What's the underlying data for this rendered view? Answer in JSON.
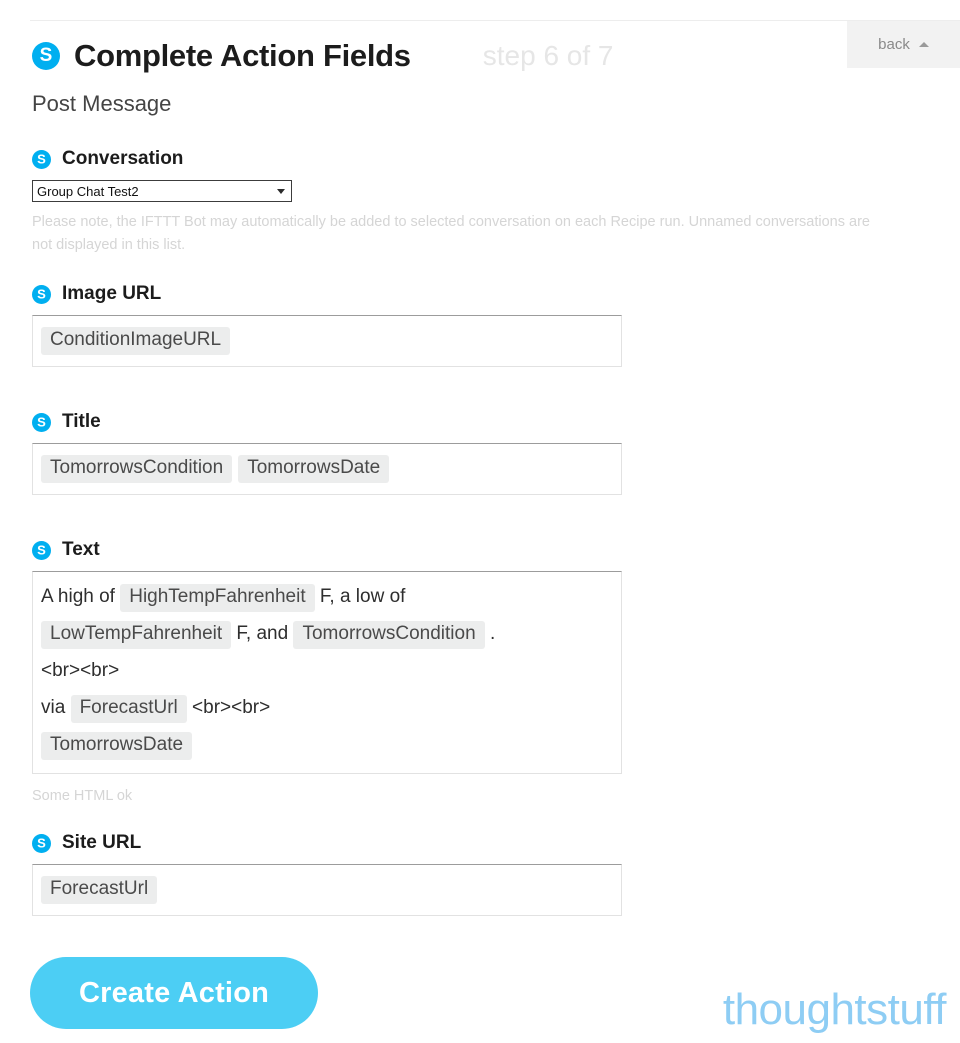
{
  "header": {
    "icon": "skype-icon",
    "title": "Complete Action Fields",
    "step": "step 6 of 7",
    "back_label": "back",
    "back_caret": "caret-up-icon",
    "subtitle": "Post Message"
  },
  "fields": {
    "conversation": {
      "icon": "skype-icon",
      "label": "Conversation",
      "selected": "Group Chat Test2",
      "caret": "caret-down-icon",
      "helper": "Please note, the IFTTT Bot may automatically be added to selected conversation on each Recipe run. Unnamed conversations are not displayed in this list."
    },
    "image_url": {
      "icon": "skype-icon",
      "label": "Image URL",
      "tokens": [
        "ConditionImageURL"
      ]
    },
    "title": {
      "icon": "skype-icon",
      "label": "Title",
      "tokens": [
        "TomorrowsCondition",
        "TomorrowsDate"
      ]
    },
    "text": {
      "icon": "skype-icon",
      "label": "Text",
      "helper": "Some HTML ok",
      "lines": [
        [
          {
            "type": "plain",
            "value": "A high of "
          },
          {
            "type": "token",
            "value": "HighTempFahrenheit"
          },
          {
            "type": "plain",
            "value": " F, a low of"
          }
        ],
        [
          {
            "type": "token",
            "value": "LowTempFahrenheit"
          },
          {
            "type": "plain",
            "value": " F, and "
          },
          {
            "type": "token",
            "value": "TomorrowsCondition"
          },
          {
            "type": "plain",
            "value": " ."
          }
        ],
        [
          {
            "type": "plain",
            "value": "<br><br>"
          }
        ],
        [
          {
            "type": "plain",
            "value": "via "
          },
          {
            "type": "token",
            "value": "ForecastUrl"
          },
          {
            "type": "plain",
            "value": " <br><br>"
          }
        ],
        [
          {
            "type": "token",
            "value": "TomorrowsDate"
          }
        ]
      ]
    },
    "site_url": {
      "icon": "skype-icon",
      "label": "Site URL",
      "tokens": [
        "ForecastUrl"
      ]
    }
  },
  "footer": {
    "create_label": "Create Action",
    "watermark": "thoughtstuff"
  },
  "colors": {
    "skype_blue": "#00aff0",
    "cta_blue": "#4ccef4",
    "token_bg": "#eceded",
    "watermark_blue": "#8ecdf4",
    "step_gray": "#e6e6e6",
    "helper_gray": "#d5d5d5"
  }
}
